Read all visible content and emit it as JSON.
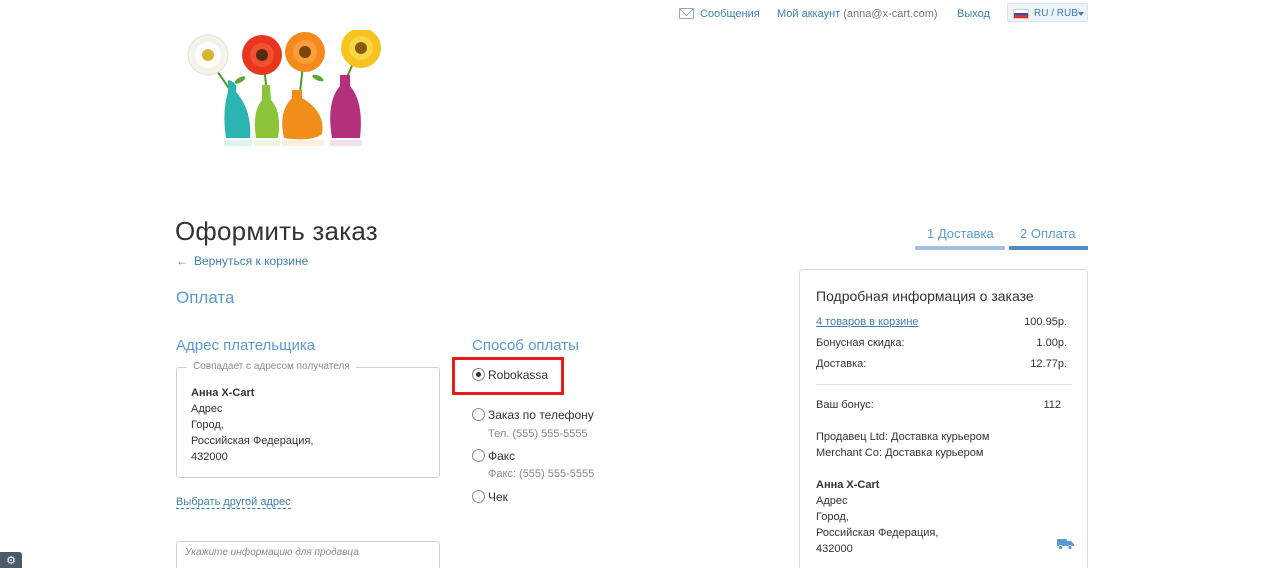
{
  "header": {
    "messages": "Сообщения",
    "account_label": "Мой аккаунт",
    "account_email": "(anna@x-cart.com)",
    "logout": "Выход",
    "language_currency": "RU / RUB",
    "flag_colors": [
      "#ffffff",
      "#2b4fb4",
      "#e03131"
    ]
  },
  "page": {
    "title": "Оформить заказ",
    "back_link": "Вернуться к корзине",
    "section": "Оплата"
  },
  "steps": [
    {
      "label": "1 Доставка",
      "state": "done"
    },
    {
      "label": "2 Оплата",
      "state": "active"
    }
  ],
  "billing": {
    "title": "Адрес плательщика",
    "legend": "Совпадает с адресом получателя",
    "name": "Анна X-Cart",
    "line1": "Адрес",
    "line2": "Город,",
    "line3": "Российская Федерация,",
    "line4": "432000",
    "choose_other": "Выбрать другой адрес",
    "notes_placeholder": "Укажите информацию для продавца"
  },
  "payment": {
    "title": "Способ оплаты",
    "options": [
      {
        "label": "Robokassa",
        "selected": true,
        "sub": ""
      },
      {
        "label": "Заказ по телефону",
        "selected": false,
        "sub": "Тел. (555) 555-5555"
      },
      {
        "label": "Факс",
        "selected": false,
        "sub": "Факс: (555) 555-5555"
      },
      {
        "label": "Чек",
        "selected": false,
        "sub": ""
      }
    ]
  },
  "summary": {
    "title": "Подробная информация о заказе",
    "items_link": "4 товаров в корзине",
    "items_value": "100.95р.",
    "bonus_discount_label": "Бонусная скидка:",
    "bonus_discount_value": "1.00р.",
    "shipping_label": "Доставка:",
    "shipping_value": "12.77р.",
    "your_bonus_label": "Ваш бонус:",
    "your_bonus_value": "112",
    "vendor1": "Продавец Ltd: Доставка курьером",
    "vendor2": "Merchant Co: Доставка курьером",
    "ship_name": "Анна X-Cart",
    "ship_line1": "Адрес",
    "ship_line2": "Город,",
    "ship_line3": "Российская Федерация,",
    "ship_line4": "432000"
  },
  "colors": {
    "accent": "#5b9ad1",
    "link": "#3d7fb3",
    "highlight": "#e61b1b"
  }
}
